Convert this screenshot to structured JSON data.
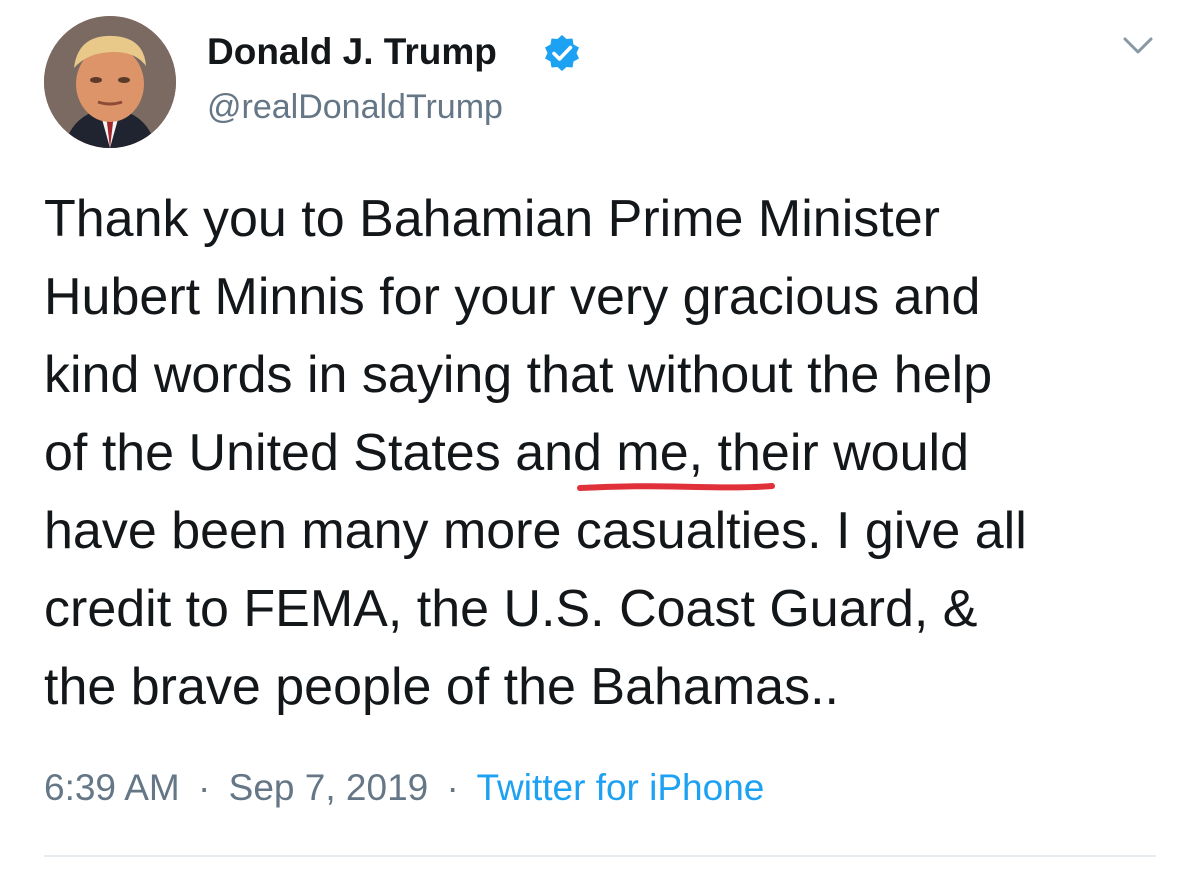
{
  "author": {
    "display_name": "Donald J. Trump",
    "handle": "@realDonaldTrump",
    "verified": true
  },
  "tweet": {
    "lines": [
      "Thank you to Bahamian Prime Minister",
      "Hubert Minnis for your very gracious and",
      "kind words in saying that without the help",
      {
        "before": "of the United States ",
        "highlight": "and me,",
        "after": " their would"
      },
      "have been many more casualties. I give all",
      "credit to FEMA, the U.S. Coast Guard, &",
      "the brave people of the Bahamas.."
    ],
    "time": "6:39 AM",
    "date": "Sep 7, 2019",
    "source": "Twitter for iPhone",
    "separator": "·"
  },
  "icons": {
    "verified": "verified-badge-icon",
    "more": "chevron-down-icon"
  },
  "colors": {
    "text": "#14171a",
    "secondary": "#657786",
    "link": "#1da1f2",
    "underline_annotation": "#e0303a",
    "divider": "#e6ecf0"
  }
}
